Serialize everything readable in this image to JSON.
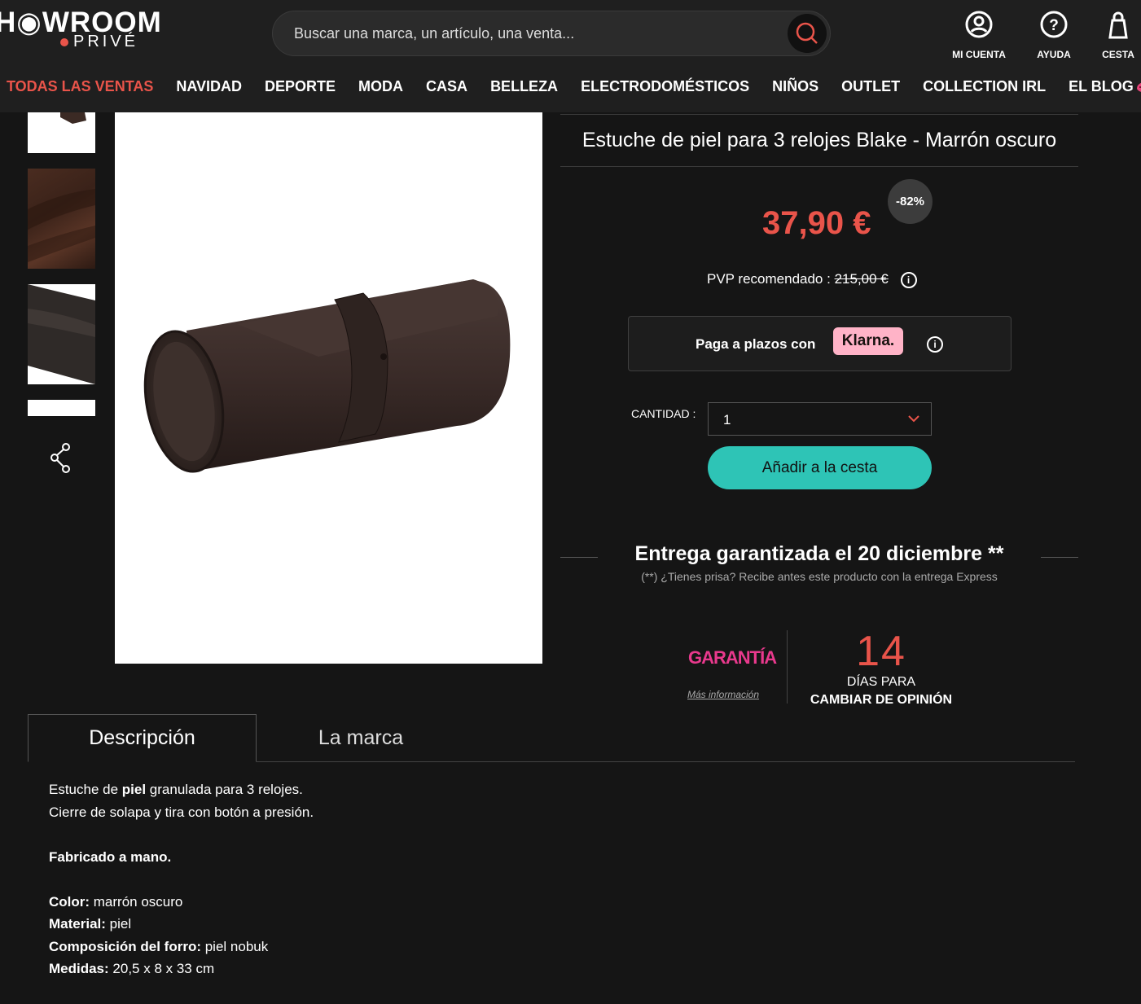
{
  "header": {
    "logo_top": "H◉WROOM",
    "logo_bottom": "PRIVÉ",
    "search_placeholder": "Buscar una marca, un artículo, una venta...",
    "account_label": "MI CUENTA",
    "help_label": "AYUDA",
    "cart_label": "CESTA"
  },
  "nav": {
    "items": [
      "TODAS LAS VENTAS",
      "NAVIDAD",
      "DEPORTE",
      "MODA",
      "CASA",
      "BELLEZA",
      "ELECTRODOMÉSTICOS",
      "NIÑOS",
      "OUTLET",
      "COLLECTION IRL",
      "EL BLOG"
    ]
  },
  "product": {
    "title": "Estuche de piel para 3 relojes Blake - Marrón oscuro",
    "price": "37,90 €",
    "discount": "-82%",
    "pvp_label": "PVP recomendado :",
    "pvp_value": "215,00 €",
    "klarna_text": "Paga a plazos con",
    "klarna_logo": "Klarna.",
    "qty_label": "CANTIDAD :",
    "qty_value": "1",
    "add_button": "Añadir a la cesta"
  },
  "delivery": {
    "title": "Entrega garantizada el 20 diciembre **",
    "subtitle": "(**) ¿Tienes prisa? Recibe antes este producto con la entrega Express"
  },
  "guarantee": {
    "badge": "GARANTÍA",
    "more_info": "Más información",
    "days": "14",
    "days_line1": "DÍAS PARA",
    "days_line2": "CAMBIAR DE OPINIÓN"
  },
  "tabs": {
    "description": "Descripción",
    "brand": "La marca"
  },
  "description": {
    "line1_a": "Estuche de ",
    "line1_b": "piel",
    "line1_c": " granulada para 3 relojes.",
    "line2": "Cierre de solapa y tira con botón a presión.",
    "handmade": "Fabricado a mano.",
    "color_label": "Color:",
    "color_value": " marrón oscuro",
    "material_label": "Material:",
    "material_value": " piel",
    "lining_label": "Composición del forro:",
    "lining_value": " piel nobuk",
    "size_label": "Medidas:",
    "size_value": " 20,5 x 8 x 33 cm"
  },
  "colors": {
    "accent": "#e9544a",
    "button": "#2ec4b6",
    "klarna": "#ffb3c7",
    "garantia": "#e9398d",
    "background": "#151515",
    "header": "#1f1f1f"
  }
}
